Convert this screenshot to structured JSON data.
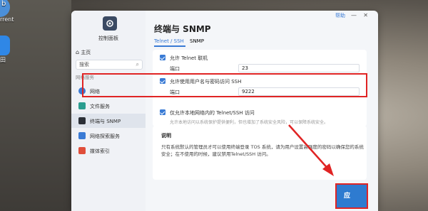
{
  "desktop": {
    "items": [
      {
        "label": "b",
        "icon": "torrent-icon"
      },
      {
        "label": "rrent",
        "icon": ""
      },
      {
        "label": "",
        "icon": "bird-icon"
      },
      {
        "label": "田",
        "icon": ""
      }
    ]
  },
  "window": {
    "help": "帮助",
    "minimize": "—",
    "close": "✕"
  },
  "sidebar": {
    "app_title": "控制面板",
    "home": "主页",
    "search_placeholder": "搜索",
    "section": "网络服务",
    "items": [
      {
        "label": "网络",
        "icon": "globe-icon",
        "color": "#3a7bd5"
      },
      {
        "label": "文件服务",
        "icon": "file-service-icon",
        "color": "#2a9d8f"
      },
      {
        "label": "终端与 SNMP",
        "icon": "terminal-icon",
        "color": "#2b2f36"
      },
      {
        "label": "网络探索服务",
        "icon": "discovery-icon",
        "color": "#3a7bd5"
      },
      {
        "label": "媒体索引",
        "icon": "media-index-icon",
        "color": "#e04e3a"
      }
    ]
  },
  "main": {
    "title": "终端与 SNMP",
    "tabs": [
      {
        "label": "Telnet / SSH"
      },
      {
        "label": "SNMP"
      }
    ],
    "telnet": {
      "label": "允许 Telnet 联机",
      "port_label": "端口",
      "port": "23"
    },
    "ssh": {
      "label": "允许使用用户名与密码访问 SSH",
      "port_label": "端口",
      "port": "9222"
    },
    "lan_only": {
      "label": "仅允许本地网络内的 Telnet/SSH 访问",
      "desc": "允许本地访问以系统保护提供便利，但也增加了系统安全风险，可以保障系统安全。"
    },
    "note": {
      "title": "说明",
      "text": "只有系统默认的管理员才可以使用终端登录 TOS 系统，请为用户设置高强度的密码以确保您的系统安全；在不使用的时候，建议禁用Telnet/SSH 访问。"
    }
  },
  "footer": {
    "apply_label": "应"
  },
  "colors": {
    "accent": "#3a7bd5",
    "highlight": "#e02424"
  }
}
